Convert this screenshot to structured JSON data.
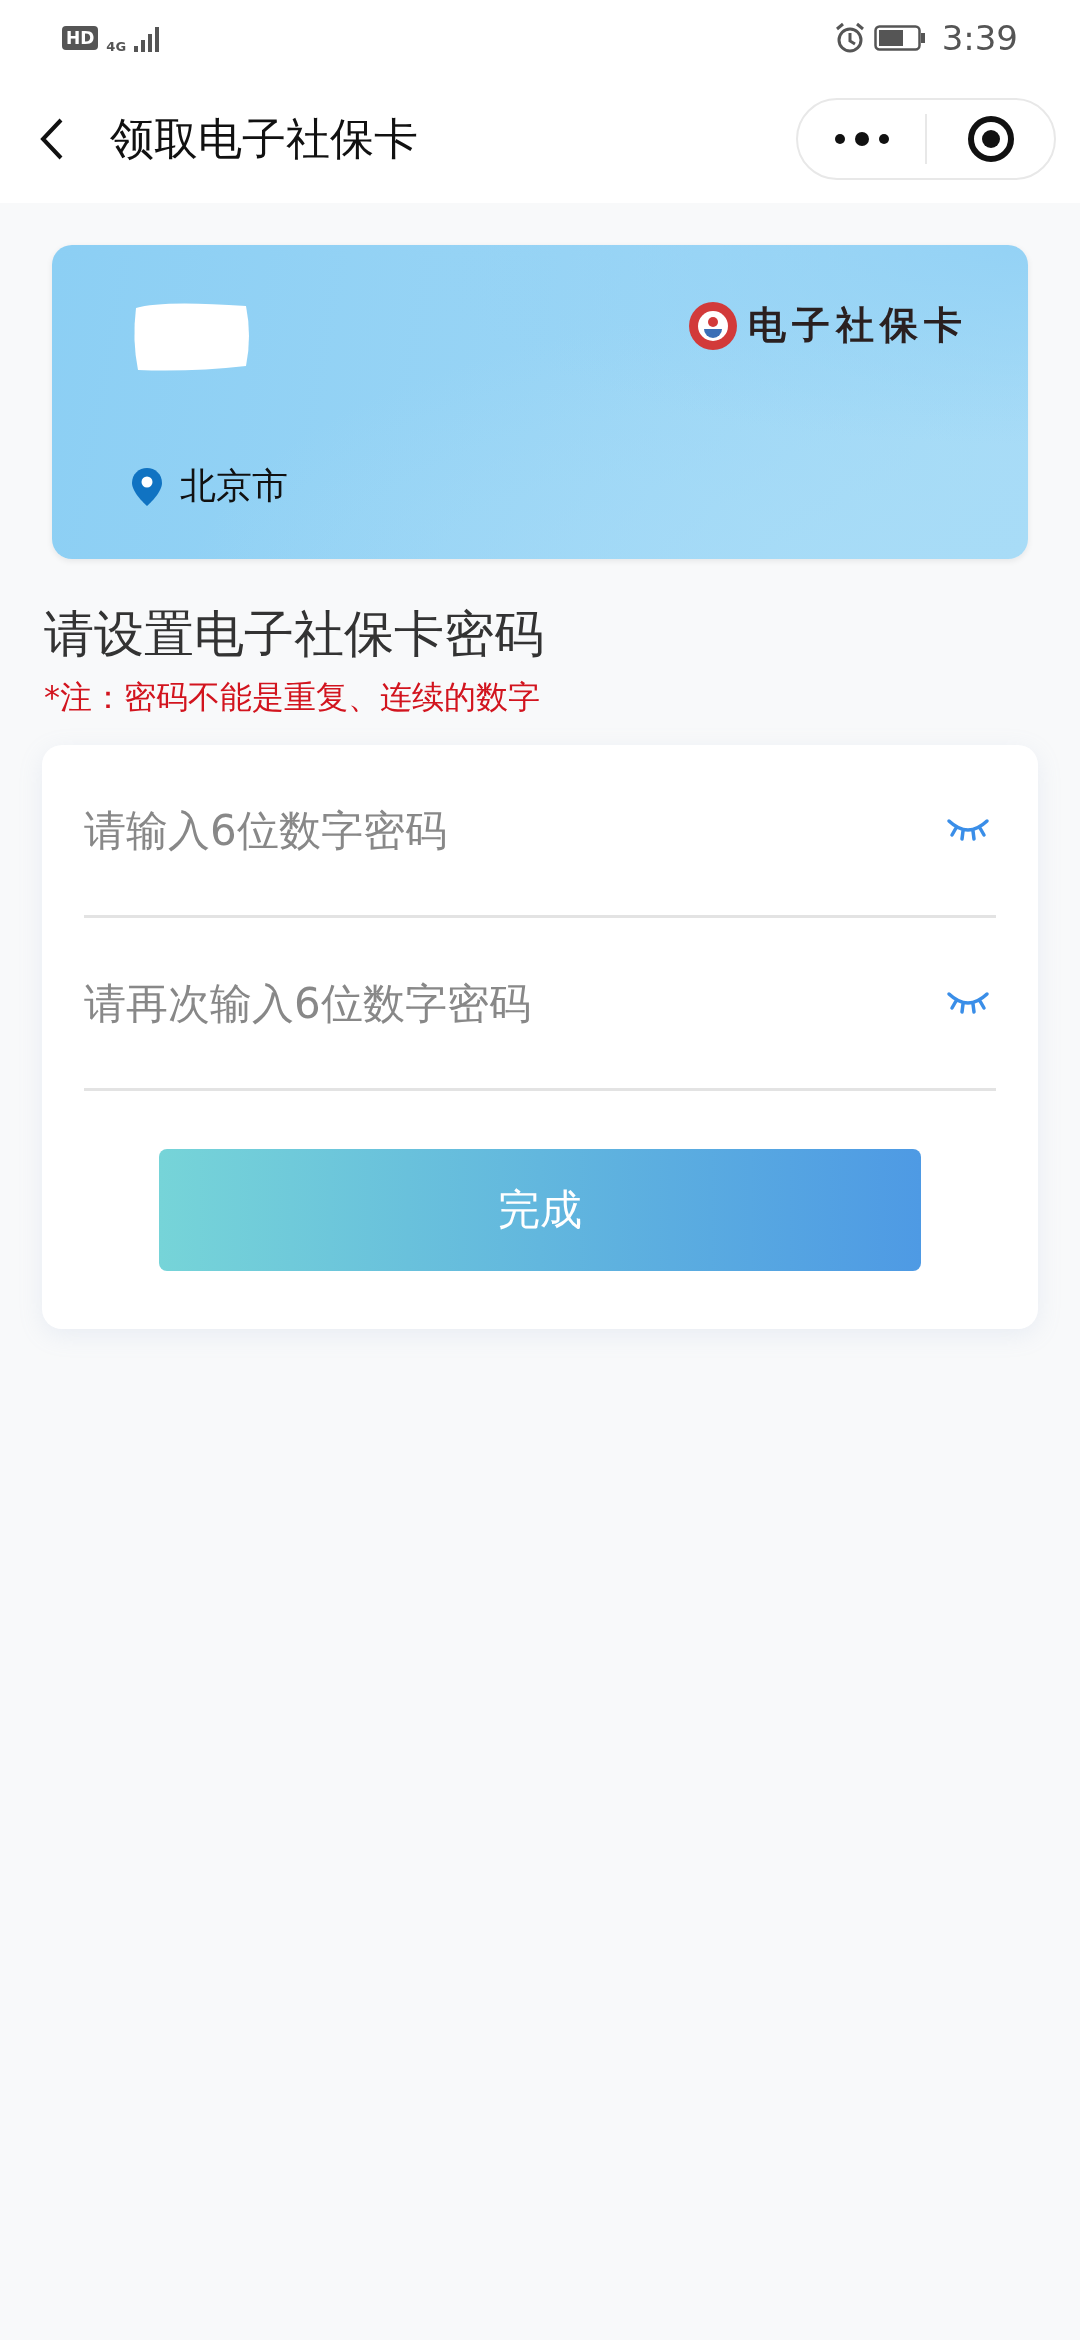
{
  "status_bar": {
    "hd": "HD",
    "network": "4G",
    "time": "3:39"
  },
  "header": {
    "title": "领取电子社保卡"
  },
  "card": {
    "logo_text": "电子社保卡",
    "location": "北京市"
  },
  "heading": "请设置电子社保卡密码",
  "note": "*注：密码不能是重复、连续的数字",
  "fields": [
    {
      "placeholder": "请输入6位数字密码"
    },
    {
      "placeholder": "请再次输入6位数字密码"
    }
  ],
  "submit_button": "完成"
}
